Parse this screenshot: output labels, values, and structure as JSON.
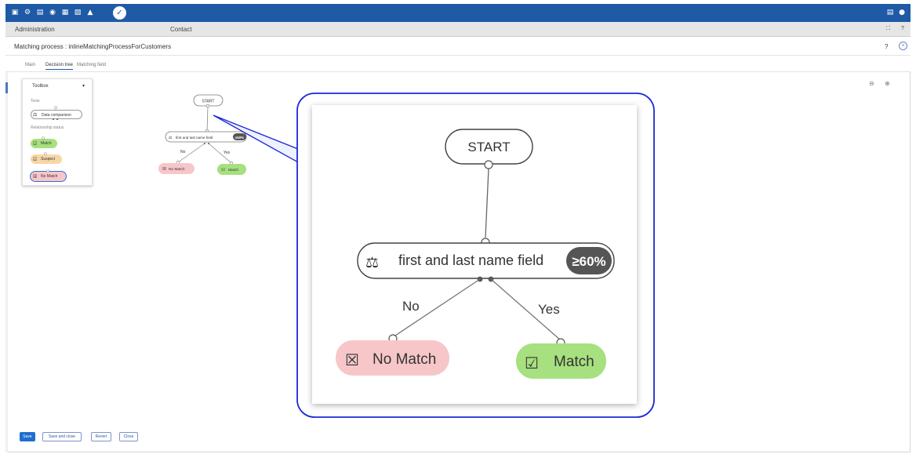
{
  "topbar": {
    "icons": [
      "database-icon",
      "settings-icon",
      "document-icon",
      "location-icon",
      "library-icon",
      "export-icon",
      "pin-icon",
      "wrench-icon"
    ],
    "right_icons": [
      "panel-icon",
      "user-icon"
    ],
    "accent": "#1f5aa6"
  },
  "subbar": {
    "left": "Administration",
    "center": "Contact"
  },
  "process": {
    "title": "Matching process : inlineMatchingProcessForCustomers",
    "help": "?",
    "close_glyph": "×"
  },
  "tabs": [
    {
      "label": "Main"
    },
    {
      "label": "Decision tree"
    },
    {
      "label": "Matching field"
    }
  ],
  "toolbox": {
    "title": "Toolbox",
    "tests_label": "Tests",
    "data_comparison": "Data comparison",
    "relationship_label": "Relationship status",
    "match": "Match",
    "suspect": "Suspect",
    "no_match": "No Match"
  },
  "tree": {
    "start": "START",
    "condition": "first and last name field",
    "threshold": "≥60%",
    "no_label": "No",
    "yes_label": "Yes",
    "no_match": "No Match",
    "match": "Match",
    "colors": {
      "no_match_fill": "#f7c6c9",
      "match_fill": "#a7e07f",
      "suspect_fill": "#f7d6a6",
      "callout_border": "#1c28d6"
    }
  },
  "actions": {
    "save": "Save",
    "save_close": "Save and close",
    "revert": "Revert",
    "close": "Close"
  }
}
